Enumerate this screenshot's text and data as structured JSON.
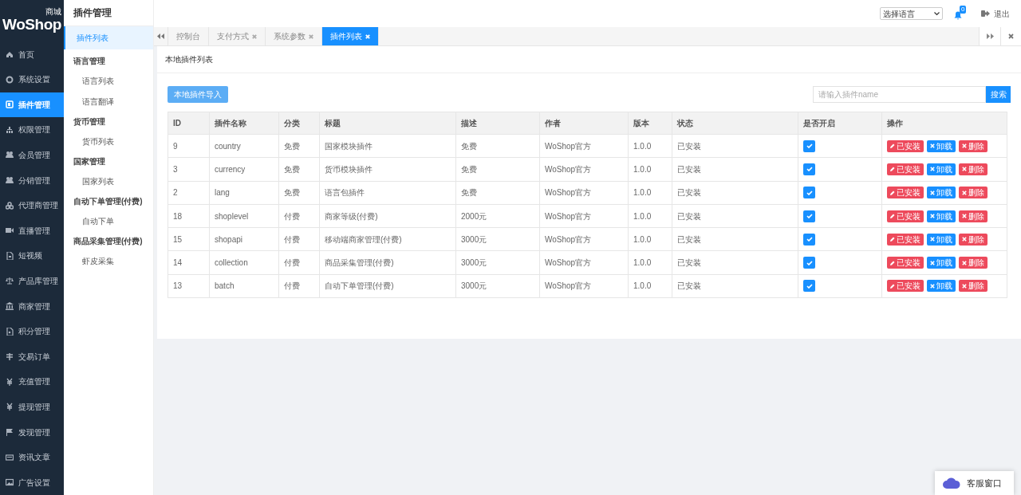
{
  "logo": {
    "text": "WoShop",
    "tag": "商城"
  },
  "sidebar": {
    "items": [
      {
        "label": "首页",
        "selected": false
      },
      {
        "label": "系统设置",
        "selected": false
      },
      {
        "label": "插件管理",
        "selected": true
      },
      {
        "label": "权限管理",
        "selected": false
      },
      {
        "label": "会员管理",
        "selected": false
      },
      {
        "label": "分销管理",
        "selected": false
      },
      {
        "label": "代理商管理",
        "selected": false
      },
      {
        "label": "直播管理",
        "selected": false
      },
      {
        "label": "短视频",
        "selected": false
      },
      {
        "label": "产品库管理",
        "selected": false
      },
      {
        "label": "商家管理",
        "selected": false
      },
      {
        "label": "积分管理",
        "selected": false
      },
      {
        "label": "交易订单",
        "selected": false
      },
      {
        "label": "充值管理",
        "selected": false
      },
      {
        "label": "提现管理",
        "selected": false
      },
      {
        "label": "发现管理",
        "selected": false
      },
      {
        "label": "资讯文章",
        "selected": false
      },
      {
        "label": "广告设置",
        "selected": false
      }
    ]
  },
  "submenu": {
    "title": "插件管理",
    "items": [
      {
        "kind": "link",
        "label": "插件列表",
        "selected": true
      },
      {
        "kind": "group",
        "label": "语言管理",
        "children": [
          {
            "label": "语言列表",
            "selected": false
          },
          {
            "label": "语言翻译",
            "selected": false
          }
        ]
      },
      {
        "kind": "group",
        "label": "货币管理",
        "children": [
          {
            "label": "货币列表",
            "selected": false
          }
        ]
      },
      {
        "kind": "group",
        "label": "国家管理",
        "children": [
          {
            "label": "国家列表",
            "selected": false
          }
        ]
      },
      {
        "kind": "group",
        "label": "自动下单管理(付费)",
        "children": [
          {
            "label": "自动下单",
            "selected": false
          }
        ]
      },
      {
        "kind": "group",
        "label": "商品采集管理(付费)",
        "children": [
          {
            "label": "虾皮采集",
            "selected": false
          }
        ]
      }
    ]
  },
  "header": {
    "language_select": "选择语言",
    "notifications": "0",
    "logout": "退出"
  },
  "tabs": [
    {
      "label": "控制台",
      "closable": false,
      "selected": false
    },
    {
      "label": "支付方式",
      "closable": true,
      "selected": false
    },
    {
      "label": "系统参数",
      "closable": true,
      "selected": false
    },
    {
      "label": "插件列表",
      "closable": true,
      "selected": true
    }
  ],
  "panel": {
    "title": "本地插件列表",
    "import_button": "本地插件导入",
    "search": {
      "placeholder": "请输入插件name",
      "button": "搜索"
    }
  },
  "table": {
    "columns": [
      "ID",
      "插件名称",
      "分类",
      "标题",
      "描述",
      "作者",
      "版本",
      "状态",
      "是否开启",
      "操作"
    ],
    "rows": [
      {
        "cells": [
          "9",
          "country",
          "免费",
          "国家模块插件",
          "免费",
          "WoShop官方",
          "1.0.0",
          "已安装"
        ],
        "enabled": true,
        "actions": [
          {
            "kind": "installed",
            "label": "已安装"
          },
          {
            "kind": "uninstall",
            "label": "卸载"
          },
          {
            "kind": "delete",
            "label": "删除"
          }
        ]
      },
      {
        "cells": [
          "3",
          "currency",
          "免费",
          "货币模块插件",
          "免费",
          "WoShop官方",
          "1.0.0",
          "已安装"
        ],
        "enabled": true,
        "actions": [
          {
            "kind": "installed",
            "label": "已安装"
          },
          {
            "kind": "uninstall",
            "label": "卸载"
          },
          {
            "kind": "delete",
            "label": "删除"
          }
        ]
      },
      {
        "cells": [
          "2",
          "lang",
          "免费",
          "语言包插件",
          "免费",
          "WoShop官方",
          "1.0.0",
          "已安装"
        ],
        "enabled": true,
        "actions": [
          {
            "kind": "installed",
            "label": "已安装"
          },
          {
            "kind": "uninstall",
            "label": "卸载"
          },
          {
            "kind": "delete",
            "label": "删除"
          }
        ]
      },
      {
        "cells": [
          "18",
          "shoplevel",
          "付费",
          "商家等级(付费)",
          "2000元",
          "WoShop官方",
          "1.0.0",
          "已安装"
        ],
        "enabled": true,
        "actions": [
          {
            "kind": "installed",
            "label": "已安装"
          },
          {
            "kind": "uninstall",
            "label": "卸载"
          },
          {
            "kind": "delete",
            "label": "删除"
          }
        ]
      },
      {
        "cells": [
          "15",
          "shopapi",
          "付费",
          "移动端商家管理(付费)",
          "3000元",
          "WoShop官方",
          "1.0.0",
          "已安装"
        ],
        "enabled": true,
        "actions": [
          {
            "kind": "installed",
            "label": "已安装"
          },
          {
            "kind": "uninstall",
            "label": "卸载"
          },
          {
            "kind": "delete",
            "label": "删除"
          }
        ]
      },
      {
        "cells": [
          "14",
          "collection",
          "付费",
          "商品采集管理(付费)",
          "3000元",
          "WoShop官方",
          "1.0.0",
          "已安装"
        ],
        "enabled": true,
        "actions": [
          {
            "kind": "installed",
            "label": "已安装"
          },
          {
            "kind": "uninstall",
            "label": "卸载"
          },
          {
            "kind": "delete",
            "label": "删除"
          }
        ]
      },
      {
        "cells": [
          "13",
          "batch",
          "付费",
          "自动下单管理(付费)",
          "3000元",
          "WoShop官方",
          "1.0.0",
          "已安装"
        ],
        "enabled": true,
        "actions": [
          {
            "kind": "installed",
            "label": "已安装"
          },
          {
            "kind": "uninstall",
            "label": "卸载"
          },
          {
            "kind": "delete",
            "label": "删除"
          }
        ]
      }
    ]
  },
  "chat_widget": {
    "label": "客服窗口"
  }
}
